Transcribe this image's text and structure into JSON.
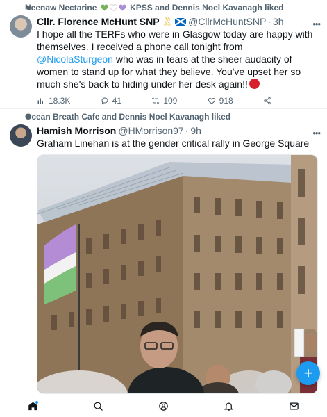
{
  "tweets": [
    {
      "social_context": {
        "prefix": "Neenaw Nectarine",
        "hearts": [
          "green",
          "white",
          "purple"
        ],
        "suffix": "KPSS and Dennis Noel Kavanagh liked"
      },
      "author": {
        "name": "Cllr. Florence McHunt SNP",
        "handle": "@CllrMcHuntSNP",
        "separator": "·",
        "time": "3h"
      },
      "text_before_mention": "I hope all the TERFs who were in Glasgow today are happy with themselves. I received a phone call tonight from ",
      "mention": "@NicolaSturgeon",
      "text_after_mention": " who was in tears at the sheer audacity of women to stand up for what they believe. You've upset her so much she's back to hiding under her desk again!!",
      "stats": {
        "views": "18.3K",
        "replies": "41",
        "retweets": "109",
        "likes": "918"
      }
    },
    {
      "social_context": {
        "text": "Ocean Breath Cafe and Dennis Noel Kavanagh liked"
      },
      "author": {
        "name": "Hamish Morrison",
        "handle": "@HMorrison97",
        "separator": "·",
        "time": "9h"
      },
      "text": "Graham Linehan is at the gender critical rally in George Square",
      "media": {
        "type": "photo",
        "flag_colors": [
          "#b48cd6",
          "#f2f2f2",
          "#7dc17a"
        ]
      }
    }
  ],
  "fab_label": "+",
  "colors": {
    "accent": "#1d9bf0",
    "text": "#0f1419",
    "muted": "#536471"
  },
  "tabs": [
    "home-icon",
    "search-icon",
    "spaces-icon",
    "notifications-icon",
    "messages-icon"
  ]
}
